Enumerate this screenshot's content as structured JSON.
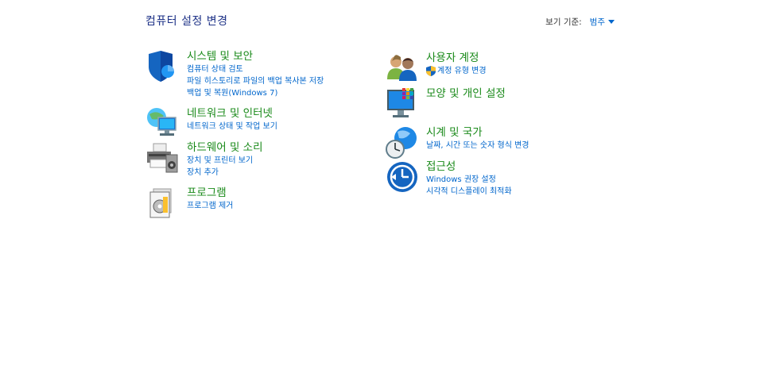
{
  "page": {
    "title": "컴퓨터 설정 변경"
  },
  "view_by": {
    "label": "보기 기준:",
    "value": "범주"
  },
  "categories": [
    {
      "head": "시스템 및 보안",
      "links": [
        "컴퓨터 상태 검토",
        "파일 히스토리로 파일의 백업 복사본 저장",
        "백업 및 복원(Windows 7)"
      ]
    },
    {
      "head": "네트워크 및 인터넷",
      "links": [
        "네트워크 상태 및 작업 보기"
      ]
    },
    {
      "head": "하드웨어 및 소리",
      "links": [
        "장치 및 프린터 보기",
        "장치 추가"
      ]
    },
    {
      "head": "프로그램",
      "links": [
        "프로그램 제거"
      ]
    },
    {
      "head": "사용자 계정",
      "links": [
        "계정 유형 변경"
      ]
    },
    {
      "head": "모양 및 개인 설정",
      "links": []
    },
    {
      "head": "시계 및 국가",
      "links": [
        "날짜, 시간 또는 숫자 형식 변경"
      ]
    },
    {
      "head": "접근성",
      "links": [
        "Windows 권장 설정",
        "시각적 디스플레이 최적화"
      ]
    }
  ],
  "icons": [
    "shield-icon",
    "network-icon",
    "printer-icon",
    "programs-icon",
    "users-icon",
    "display-icon",
    "clock-globe-icon",
    "accessibility-icon"
  ]
}
